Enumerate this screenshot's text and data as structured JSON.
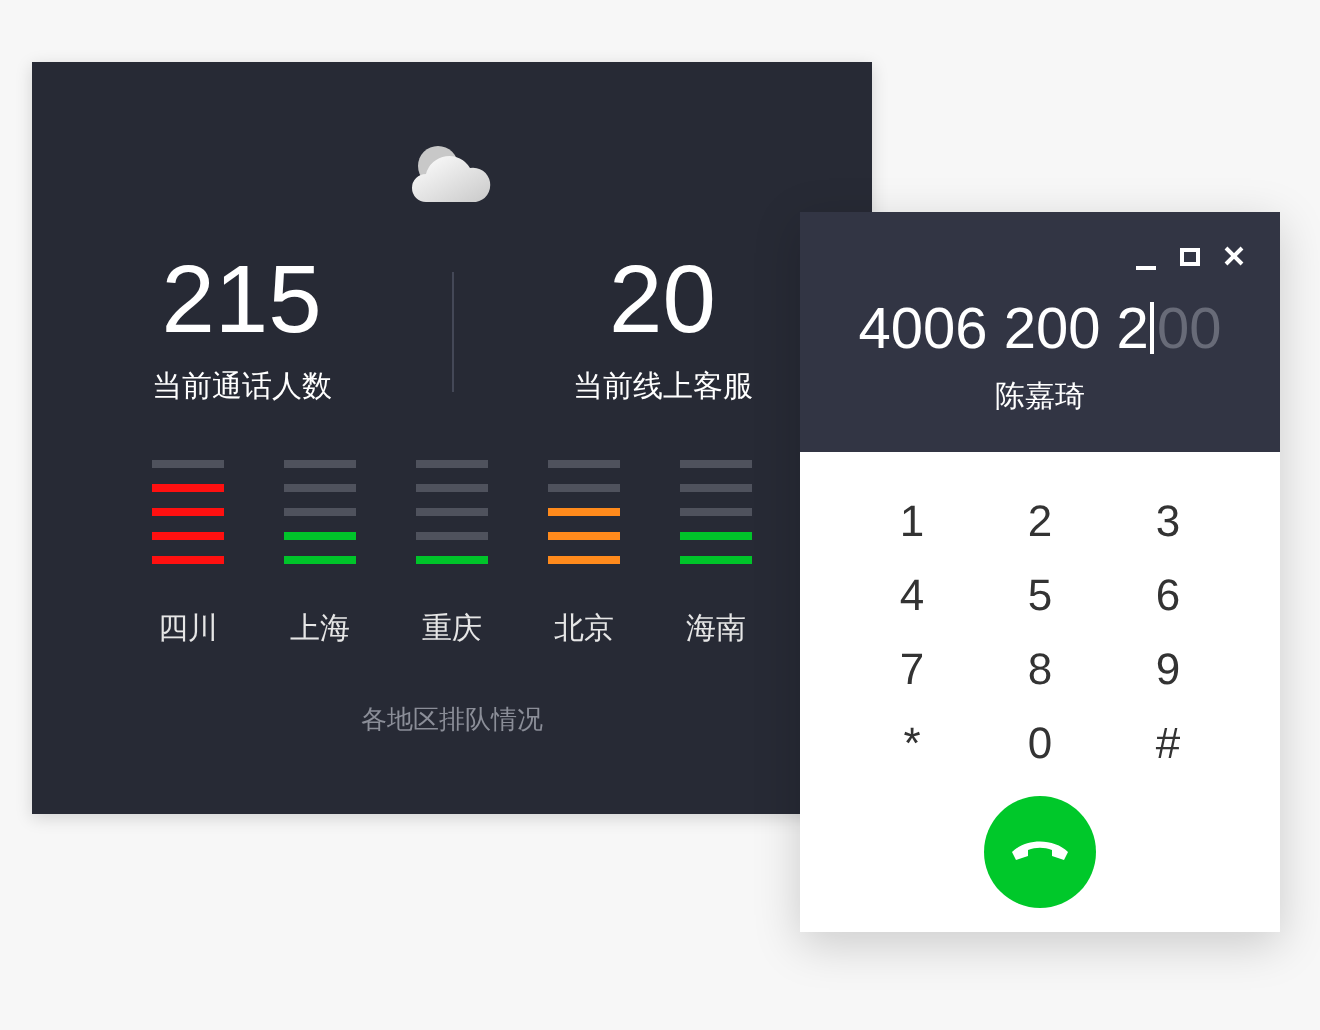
{
  "stats": [
    {
      "value": "215",
      "label": "当前通话人数"
    },
    {
      "value": "20",
      "label": "当前线上客服"
    }
  ],
  "regions": [
    {
      "name": "四川",
      "color": "#ff1010",
      "bars": [
        {
          "on": false
        },
        {
          "on": true
        },
        {
          "on": true
        },
        {
          "on": true
        },
        {
          "on": true
        }
      ]
    },
    {
      "name": "上海",
      "color": "#00c42a",
      "bars": [
        {
          "on": false
        },
        {
          "on": false
        },
        {
          "on": false
        },
        {
          "on": true
        },
        {
          "on": true
        }
      ]
    },
    {
      "name": "重庆",
      "color": "#00c42a",
      "bars": [
        {
          "on": false
        },
        {
          "on": false
        },
        {
          "on": false
        },
        {
          "on": false
        },
        {
          "on": true
        }
      ]
    },
    {
      "name": "北京",
      "color": "#ff8a1c",
      "bars": [
        {
          "on": false
        },
        {
          "on": false
        },
        {
          "on": true
        },
        {
          "on": true
        },
        {
          "on": true
        }
      ]
    },
    {
      "name": "海南",
      "color": "#00c42a",
      "bars": [
        {
          "on": false
        },
        {
          "on": false
        },
        {
          "on": false
        },
        {
          "on": true
        },
        {
          "on": true
        }
      ]
    }
  ],
  "caption": "各地区排队情况",
  "dialer": {
    "number": "4006 200 2",
    "suggestion": "00",
    "contact": "陈嘉琦",
    "keys": [
      "1",
      "2",
      "3",
      "4",
      "5",
      "6",
      "7",
      "8",
      "9",
      "*",
      "0",
      "#"
    ]
  }
}
